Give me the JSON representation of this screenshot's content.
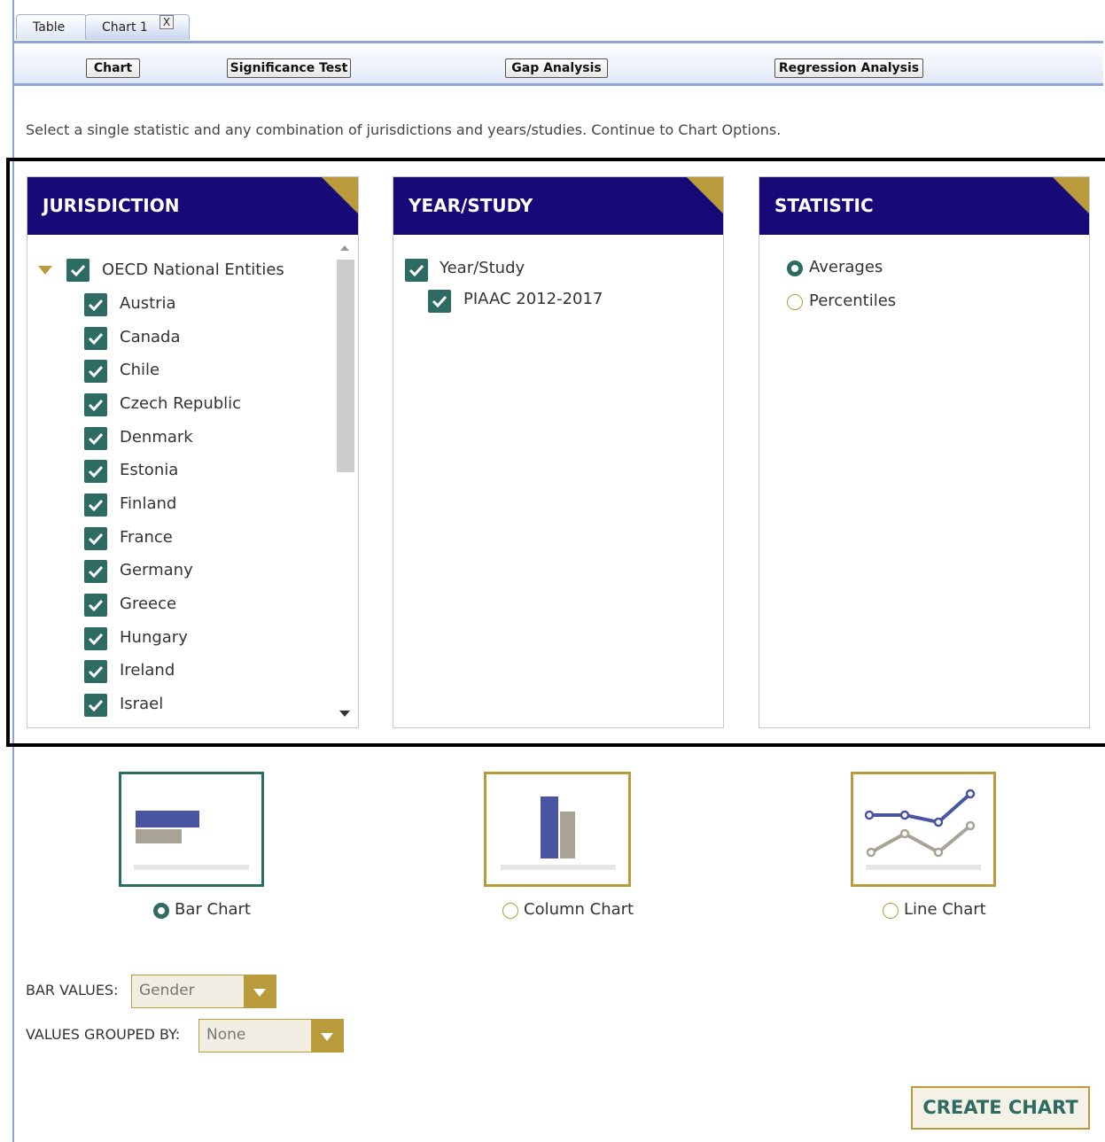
{
  "tabs": [
    {
      "label": "Table"
    },
    {
      "label": "Chart 1",
      "close_label": "X"
    }
  ],
  "toolbar": {
    "buttons": [
      "Chart",
      "Significance Test",
      "Gap Analysis",
      "Regression Analysis"
    ]
  },
  "instruction": "Select a single statistic and any combination of jurisdictions and years/studies. Continue to Chart Options.",
  "panels": {
    "jurisdiction": {
      "title": "JURISDICTION",
      "group_label": "OECD National Entities",
      "items": [
        "Austria",
        "Canada",
        "Chile",
        "Czech Republic",
        "Denmark",
        "Estonia",
        "Finland",
        "France",
        "Germany",
        "Greece",
        "Hungary",
        "Ireland",
        "Israel"
      ]
    },
    "year_study": {
      "title": "YEAR/STUDY",
      "group_label": "Year/Study",
      "items": [
        "PIAAC 2012-2017"
      ]
    },
    "statistic": {
      "title": "STATISTIC",
      "options": [
        "Averages",
        "Percentiles"
      ],
      "selected": "Averages"
    }
  },
  "chart_types": {
    "options": [
      "Bar Chart",
      "Column Chart",
      "Line Chart"
    ],
    "selected": "Bar Chart"
  },
  "bar_values": {
    "label": "BAR VALUES:",
    "value": "Gender"
  },
  "grouped_by": {
    "label": "VALUES GROUPED BY:",
    "value": "None"
  },
  "create_button": "CREATE CHART",
  "colors": {
    "header_navy": "#170a78",
    "accent_gold": "#b99b3c",
    "check_green": "#2d6b63",
    "icon_blue": "#4a55a2",
    "icon_gray": "#a8a395"
  }
}
